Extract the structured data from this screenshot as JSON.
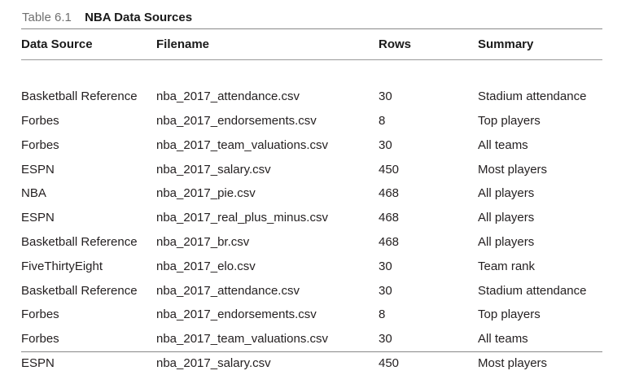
{
  "caption": {
    "number": "Table 6.1",
    "title": "NBA Data Sources"
  },
  "table": {
    "headers": [
      "Data Source",
      "Filename",
      "Rows",
      "Summary"
    ],
    "rows": [
      [
        "Basketball Reference",
        "nba_2017_attendance.csv",
        "30",
        "Stadium attendance"
      ],
      [
        "Forbes",
        "nba_2017_endorsements.csv",
        "8",
        "Top players"
      ],
      [
        "Forbes",
        "nba_2017_team_valuations.csv",
        "30",
        "All teams"
      ],
      [
        "ESPN",
        "nba_2017_salary.csv",
        "450",
        "Most players"
      ],
      [
        "NBA",
        "nba_2017_pie.csv",
        "468",
        "All players"
      ],
      [
        "ESPN",
        "nba_2017_real_plus_minus.csv",
        "468",
        "All players"
      ],
      [
        "Basketball Reference",
        "nba_2017_br.csv",
        "468",
        "All players"
      ],
      [
        "FiveThirtyEight",
        "nba_2017_elo.csv",
        "30",
        "Team rank"
      ],
      [
        "Basketball Reference",
        "nba_2017_attendance.csv",
        "30",
        "Stadium attendance"
      ],
      [
        "Forbes",
        "nba_2017_endorsements.csv",
        "8",
        "Top players"
      ],
      [
        "Forbes",
        "nba_2017_team_valuations.csv",
        "30",
        "All teams"
      ],
      [
        "ESPN",
        "nba_2017_salary.csv",
        "450",
        "Most players"
      ]
    ]
  }
}
